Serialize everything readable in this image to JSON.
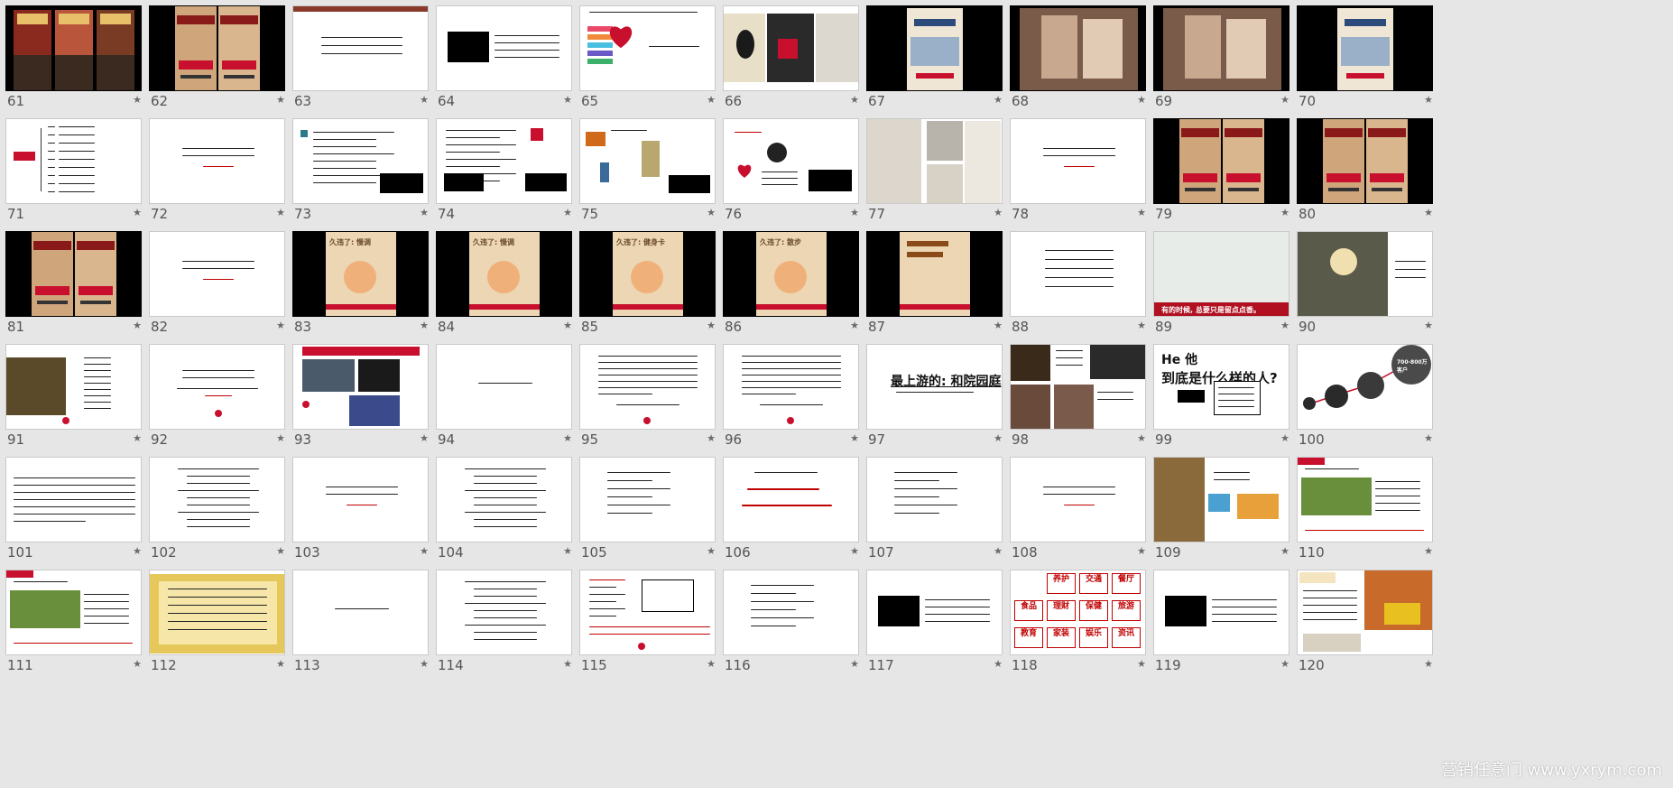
{
  "slides": [
    {
      "n": "61",
      "style": "black",
      "kind": "posters3"
    },
    {
      "n": "62",
      "style": "black",
      "kind": "posters2"
    },
    {
      "n": "63",
      "style": "white",
      "kind": "header-text"
    },
    {
      "n": "64",
      "style": "white",
      "kind": "blackbox-text"
    },
    {
      "n": "65",
      "style": "white",
      "kind": "heart-bars"
    },
    {
      "n": "66",
      "style": "white",
      "kind": "photos-dark"
    },
    {
      "n": "67",
      "style": "black",
      "kind": "poster1"
    },
    {
      "n": "68",
      "style": "black",
      "kind": "photo-people"
    },
    {
      "n": "69",
      "style": "black",
      "kind": "photo-people"
    },
    {
      "n": "70",
      "style": "black",
      "kind": "poster1"
    },
    {
      "n": "71",
      "style": "white",
      "kind": "tree"
    },
    {
      "n": "72",
      "style": "white",
      "kind": "centered-red"
    },
    {
      "n": "73",
      "style": "white",
      "kind": "list-box"
    },
    {
      "n": "74",
      "style": "white",
      "kind": "list-logo"
    },
    {
      "n": "75",
      "style": "white",
      "kind": "collage"
    },
    {
      "n": "76",
      "style": "white",
      "kind": "heart-clock"
    },
    {
      "n": "77",
      "style": "white",
      "kind": "photo-sculpture"
    },
    {
      "n": "78",
      "style": "white",
      "kind": "centered-red"
    },
    {
      "n": "79",
      "style": "black",
      "kind": "posters2"
    },
    {
      "n": "80",
      "style": "black",
      "kind": "posters2"
    },
    {
      "n": "81",
      "style": "black",
      "kind": "posters2"
    },
    {
      "n": "82",
      "style": "white",
      "kind": "centered-red"
    },
    {
      "n": "83",
      "style": "black",
      "kind": "poster-beige",
      "text": "久违了: 慢调"
    },
    {
      "n": "84",
      "style": "black",
      "kind": "poster-beige",
      "text": "久违了: 慢调"
    },
    {
      "n": "85",
      "style": "black",
      "kind": "poster-beige",
      "text": "久违了: 健身卡"
    },
    {
      "n": "86",
      "style": "black",
      "kind": "poster-beige",
      "text": "久违了: 散步"
    },
    {
      "n": "87",
      "style": "black",
      "kind": "poster-beige2"
    },
    {
      "n": "88",
      "style": "white",
      "kind": "centered-lines"
    },
    {
      "n": "89",
      "style": "white",
      "kind": "photo-redbar",
      "text": "有的时候, 总要只是留点点香。"
    },
    {
      "n": "90",
      "style": "white",
      "kind": "photo-tree"
    },
    {
      "n": "91",
      "style": "white",
      "kind": "photo-list"
    },
    {
      "n": "92",
      "style": "white",
      "kind": "centered-red-logo"
    },
    {
      "n": "93",
      "style": "white",
      "kind": "photos-red"
    },
    {
      "n": "94",
      "style": "white",
      "kind": "single-line"
    },
    {
      "n": "95",
      "style": "white",
      "kind": "para-logo"
    },
    {
      "n": "96",
      "style": "white",
      "kind": "para-logo"
    },
    {
      "n": "97",
      "style": "white",
      "kind": "title-text",
      "text": "最上游的: 和院园庭"
    },
    {
      "n": "98",
      "style": "white",
      "kind": "photo-grid"
    },
    {
      "n": "99",
      "style": "white",
      "kind": "he-title",
      "text1": "He 他",
      "text2": "到底是什么样的人?"
    },
    {
      "n": "100",
      "style": "white",
      "kind": "circles",
      "text": "700-800万 客户"
    },
    {
      "n": "101",
      "style": "white",
      "kind": "paragraph"
    },
    {
      "n": "102",
      "style": "white",
      "kind": "list-centered"
    },
    {
      "n": "103",
      "style": "white",
      "kind": "centered-red"
    },
    {
      "n": "104",
      "style": "white",
      "kind": "list-centered"
    },
    {
      "n": "105",
      "style": "white",
      "kind": "list-short"
    },
    {
      "n": "106",
      "style": "white",
      "kind": "red-title"
    },
    {
      "n": "107",
      "style": "white",
      "kind": "list-short"
    },
    {
      "n": "108",
      "style": "white",
      "kind": "centered-red"
    },
    {
      "n": "109",
      "style": "white",
      "kind": "photo-mats"
    },
    {
      "n": "110",
      "style": "white",
      "kind": "green-panel"
    },
    {
      "n": "111",
      "style": "white",
      "kind": "green-panel"
    },
    {
      "n": "112",
      "style": "white",
      "kind": "scroll"
    },
    {
      "n": "113",
      "style": "white",
      "kind": "single-line"
    },
    {
      "n": "114",
      "style": "white",
      "kind": "list-centered"
    },
    {
      "n": "115",
      "style": "white",
      "kind": "boxed-list"
    },
    {
      "n": "116",
      "style": "white",
      "kind": "list-short"
    },
    {
      "n": "117",
      "style": "white",
      "kind": "blackbox-text"
    },
    {
      "n": "118",
      "style": "white",
      "kind": "red-grid",
      "cells": [
        "养护",
        "交通",
        "餐厅",
        "食品",
        "理财",
        "保健",
        "旅游",
        "教育",
        "家装",
        "娱乐",
        "资讯"
      ]
    },
    {
      "n": "119",
      "style": "white",
      "kind": "blackbox-text"
    },
    {
      "n": "120",
      "style": "white",
      "kind": "web-collage"
    }
  ],
  "watermark": {
    "text": "营销任意门  www.yxrym.com"
  },
  "colors": {
    "background": "#e6e6e6",
    "accent": "#c8102e",
    "text": "#111111"
  },
  "icons": {
    "star": "star-icon"
  }
}
